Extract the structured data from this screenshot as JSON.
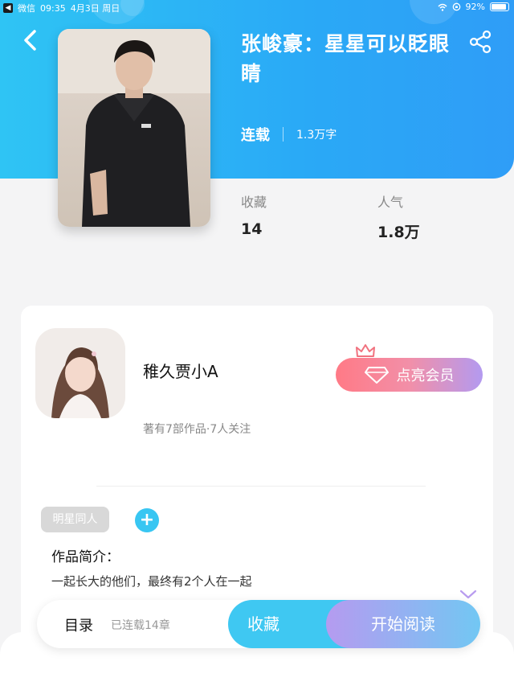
{
  "status_bar": {
    "carrier": "微信",
    "time": "09:35",
    "date": "4月3日 周日",
    "battery": "92%",
    "battery_level": 0.92
  },
  "book": {
    "title": "张峻豪：星星可以眨眼睛",
    "status": "连载",
    "word_count": "1.3万字"
  },
  "stats": [
    {
      "label": "收藏",
      "value": "14"
    },
    {
      "label": "人气",
      "value": "1.8万"
    }
  ],
  "author": {
    "name": "稚久贾小A",
    "meta": "著有7部作品·7人关注",
    "vip_label": "点亮会员"
  },
  "tags": [
    {
      "label": "明星同人"
    }
  ],
  "add_tag_symbol": "+",
  "intro": {
    "heading": "作品简介：",
    "text": "一起长大的他们，最终有2个人在一起"
  },
  "bottom_bar": {
    "toc_label": "目录",
    "toc_status": "已连载14章",
    "collect_label": "收藏",
    "read_label": "开始阅读"
  },
  "colors": {
    "header_blue": "#2aa9f6",
    "accent_cyan": "#3fc8f2",
    "vip_pink": "#ff7a86",
    "vip_purple": "#b39af0"
  },
  "icons": [
    "back-icon",
    "share-icon",
    "crown-icon",
    "diamond-icon",
    "expand-icon",
    "wifi-icon",
    "lock-rotation-icon"
  ]
}
